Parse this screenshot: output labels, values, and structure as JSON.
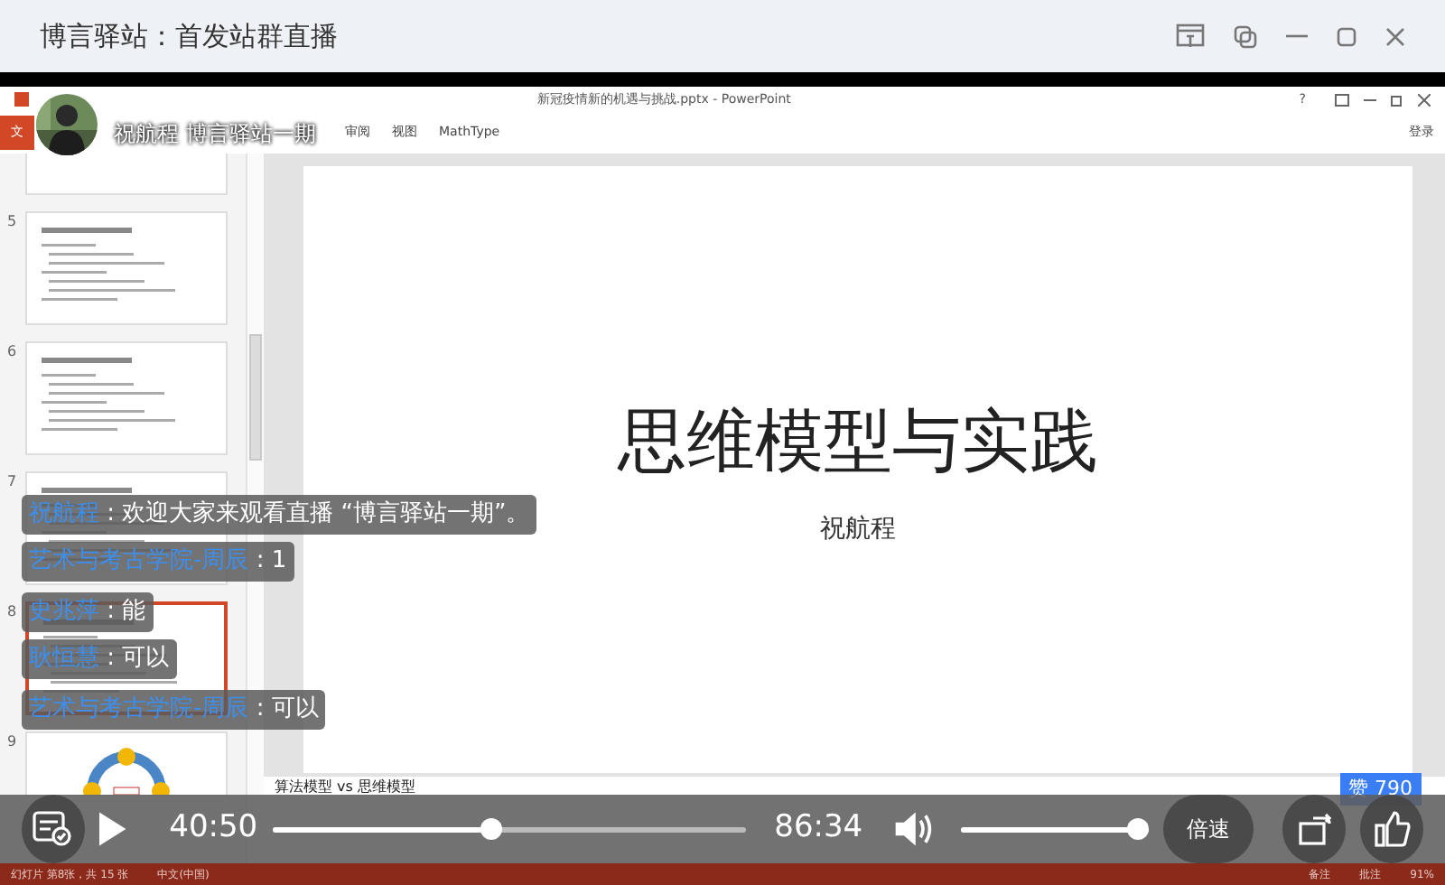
{
  "window": {
    "title": "博言驿站：首发站群直播"
  },
  "powerpoint": {
    "title": "新冠疫情新的机遇与挑战.pptx - PowerPoint",
    "help": "?",
    "ribbon_tabs": [
      {
        "label": "文",
        "selected": true
      },
      {
        "label": "审阅",
        "selected": false
      },
      {
        "label": "视图",
        "selected": false
      },
      {
        "label": "MathType",
        "selected": false
      }
    ],
    "sign_in": "登录",
    "thumbnails": [
      {
        "selected": false,
        "kind": "blank"
      },
      {
        "number": "5",
        "selected": false,
        "kind": "text"
      },
      {
        "number": "6",
        "selected": false,
        "kind": "text"
      },
      {
        "number": "7",
        "selected": false,
        "kind": "text"
      },
      {
        "number": "8",
        "selected": true,
        "kind": "text"
      },
      {
        "number": "9",
        "selected": false,
        "kind": "diagram"
      }
    ],
    "slide": {
      "title": "思维模型与实践",
      "subtitle": "祝航程"
    },
    "notes": "算法模型 vs 思维模型",
    "status_bar": {
      "slide_count": "幻灯片 第8张，共 15 张",
      "language": "中文(中国)",
      "notes": "备注",
      "comments": "批注",
      "zoom": "91%"
    }
  },
  "host": {
    "caption": "祝航程 博言驿站一期"
  },
  "comments": [
    {
      "name": "祝航程",
      "text": " : 欢迎大家来观看直播 “博言驿站一期”。"
    },
    {
      "name": "艺术与考古学院-周辰",
      "text": " : 1"
    },
    {
      "name": "史兆萍",
      "text": " : 能"
    },
    {
      "name": "耿恒慧",
      "text": " : 可以"
    },
    {
      "name": "艺术与考古学院-周辰",
      "text": " : 可以"
    }
  ],
  "player": {
    "current_time": "40:50",
    "duration": "86:34",
    "progress": {
      "level": 0.46
    },
    "volume": {
      "level": 1.0
    },
    "speed_button": "倍速",
    "likes": "赞 790"
  }
}
